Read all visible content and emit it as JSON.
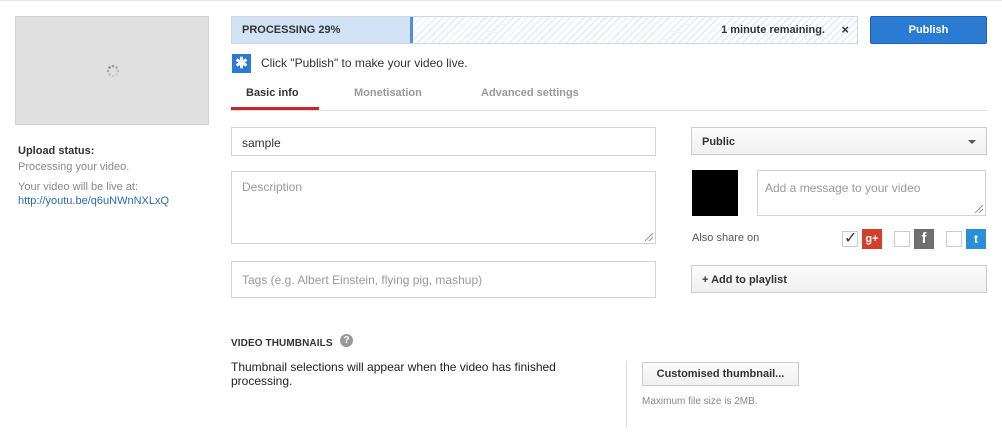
{
  "upload": {
    "status_label": "Upload status:",
    "status_text": "Processing your video.",
    "live_text": "Your video will be live at:",
    "url": "http://youtu.be/q6uNWnNXLxQ"
  },
  "progress": {
    "label": "PROCESSING 29%",
    "percent": 29,
    "remaining": "1 minute remaining.",
    "close": "×"
  },
  "publish_label": "Publish",
  "hint": "Click \"Publish\" to make your video live.",
  "tabs": [
    {
      "label": "Basic info",
      "active": true
    },
    {
      "label": "Monetisation",
      "active": false
    },
    {
      "label": "Advanced settings",
      "active": false
    }
  ],
  "form": {
    "title_value": "sample",
    "description_placeholder": "Description",
    "tags_placeholder": "Tags (e.g. Albert Einstein, flying pig, mashup)"
  },
  "privacy": {
    "selected": "Public"
  },
  "share": {
    "message_placeholder": "Add a message to your video",
    "also_share_label": "Also share on",
    "gplus_checked": true,
    "facebook_checked": false,
    "twitter_checked": false
  },
  "playlist_label": "+ Add to playlist",
  "thumbnails": {
    "title": "VIDEO THUMBNAILS",
    "help": "?",
    "description": "Thumbnail selections will appear when the video has finished processing.",
    "custom_button": "Customised thumbnail...",
    "max_size": "Maximum file size is 2MB."
  },
  "icons": {
    "hint": "star-icon",
    "spinner": "loading-spinner-icon",
    "gplus": "google-plus-icon",
    "facebook": "facebook-icon",
    "twitter": "twitter-icon"
  },
  "colors": {
    "publish": "#2b7bd3",
    "tab_active_underline": "#c8252b",
    "link": "#2a6bb5"
  }
}
